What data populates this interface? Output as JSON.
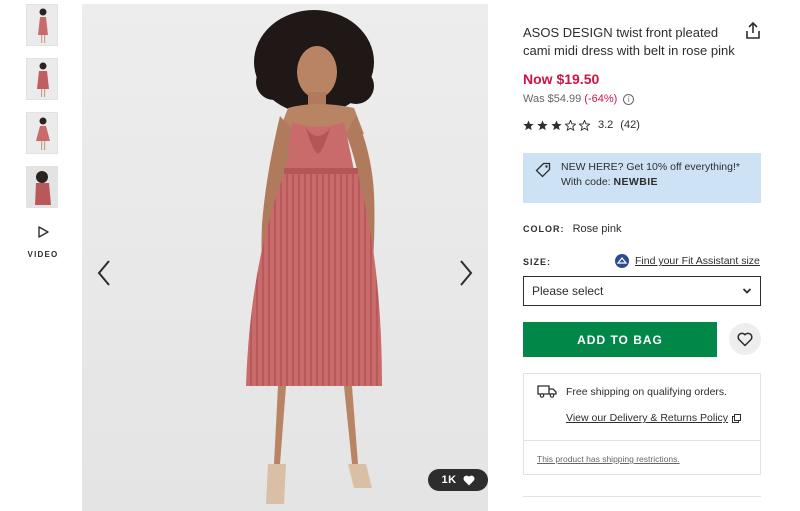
{
  "gallery": {
    "thumbnails": [
      "thumbnail-1",
      "thumbnail-2",
      "thumbnail-3",
      "thumbnail-4"
    ],
    "video_label": "VIDEO",
    "likes_count": "1K"
  },
  "product": {
    "title": "ASOS DESIGN twist front pleated cami midi dress with belt in rose pink",
    "now_price": "Now $19.50",
    "was_label": "Was $54.99",
    "discount": "(-64%)",
    "rating_value": "3.2",
    "rating_count": "(42)",
    "rating_stars": 3.2,
    "promo_line1": "NEW HERE? Get 10% off everything!*",
    "promo_line2_prefix": "With code:",
    "promo_code": "NEWBIE",
    "color_label": "COLOR:",
    "color_value": "Rose pink",
    "size_label": "SIZE:",
    "fit_assistant_link": "Find your Fit Assistant size",
    "size_placeholder": "Please select",
    "add_to_bag": "ADD TO BAG",
    "shipping_text": "Free shipping on qualifying orders.",
    "delivery_link": "View our Delivery & Returns Policy",
    "restriction_link": "This product has shipping restrictions."
  },
  "colors": {
    "price_red": "#d01345",
    "bag_green": "#018849",
    "promo_blue": "#cde2f5",
    "dress_rose": "#c96a6b"
  },
  "icons": [
    "share-icon",
    "info-icon",
    "star-icon",
    "tag-icon",
    "play-icon",
    "chevron-left-icon",
    "chevron-right-icon",
    "heart-icon",
    "chevron-down-icon",
    "truck-icon",
    "external-link-icon",
    "fit-assistant-icon"
  ]
}
